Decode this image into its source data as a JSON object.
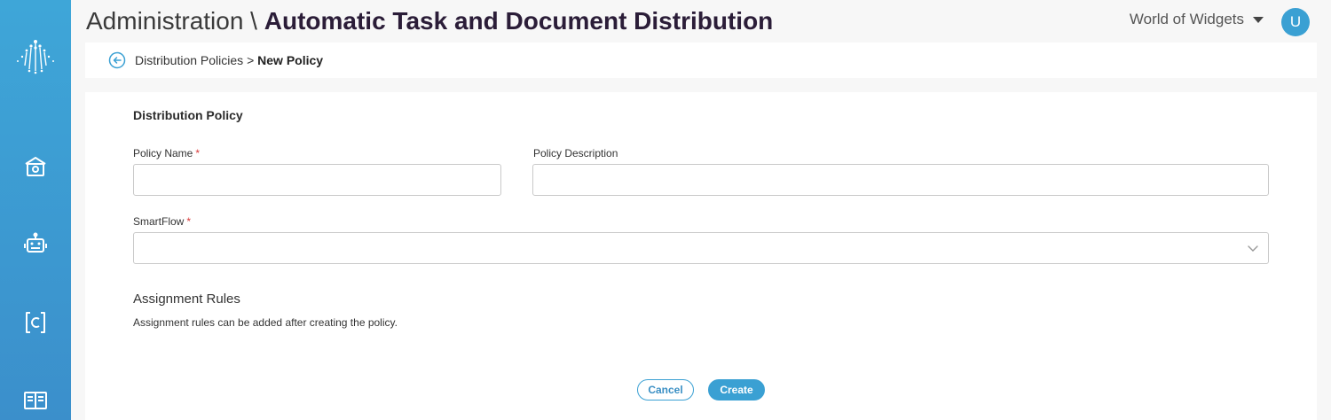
{
  "header": {
    "title_prefix": "Administration \\",
    "title_main": "Automatic Task and Document Distribution",
    "org_name": "World of Widgets",
    "avatar_initial": "U"
  },
  "breadcrumb": {
    "parent": "Distribution Policies",
    "separator": ">",
    "current": "New Policy"
  },
  "form": {
    "section_title": "Distribution Policy",
    "policy_name_label": "Policy Name",
    "policy_name_value": "",
    "policy_description_label": "Policy Description",
    "policy_description_value": "",
    "smartflow_label": "SmartFlow",
    "smartflow_value": "",
    "required_mark": "*",
    "assignment_title": "Assignment Rules",
    "assignment_help": "Assignment rules can be added after creating the policy."
  },
  "actions": {
    "cancel_label": "Cancel",
    "create_label": "Create"
  },
  "sidebar": {
    "items": [
      {
        "icon": "home-icon"
      },
      {
        "icon": "robot-icon"
      },
      {
        "icon": "code-bracket-icon"
      },
      {
        "icon": "book-icon"
      }
    ]
  },
  "colors": {
    "accent": "#3aa0d3",
    "required": "#d93a3a",
    "sidebar_top": "#3ea6d8",
    "sidebar_bottom": "#3b8fcb"
  }
}
